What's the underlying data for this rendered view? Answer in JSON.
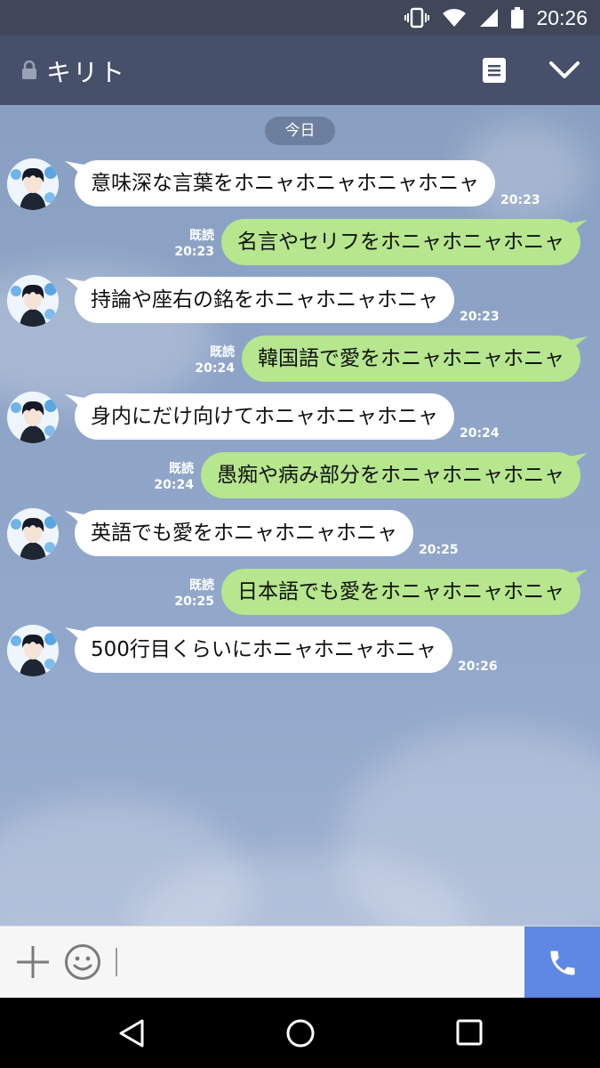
{
  "status_bar": {
    "time": "20:26",
    "icons": [
      "vibrate-icon",
      "wifi-icon",
      "signal-icon",
      "battery-icon"
    ]
  },
  "header": {
    "title": "キリト",
    "icons": [
      "lock-icon",
      "memo-icon",
      "chevron-down-icon"
    ]
  },
  "chat": {
    "date_label": "今日",
    "messages": [
      {
        "dir": "in",
        "text": "意味深な言葉をホニャホニャホニャホニャ",
        "time": "20:23"
      },
      {
        "dir": "out",
        "read": "既読",
        "text": "名言やセリフをホニャホニャホニャ",
        "time": "20:23"
      },
      {
        "dir": "in",
        "text": "持論や座右の銘をホニャホニャホニャ",
        "time": "20:23"
      },
      {
        "dir": "out",
        "read": "既読",
        "text": "韓国語で愛をホニャホニャホニャ",
        "time": "20:24"
      },
      {
        "dir": "in",
        "text": "身内にだけ向けてホニャホニャホニャ",
        "time": "20:24"
      },
      {
        "dir": "out",
        "read": "既読",
        "text": "愚痴や病み部分をホニャホニャホニャ",
        "time": "20:24"
      },
      {
        "dir": "in",
        "text": "英語でも愛をホニャホニャホニャ",
        "time": "20:25"
      },
      {
        "dir": "out",
        "read": "既読",
        "text": "日本語でも愛をホニャホニャホニャ",
        "time": "20:25"
      },
      {
        "dir": "in",
        "text": "500行目くらいにホニャホニャホニャ",
        "time": "20:26"
      }
    ]
  },
  "input_bar": {
    "icons": [
      "plus-icon",
      "smile-icon",
      "phone-icon"
    ]
  },
  "nav_bar": {
    "icons": [
      "back-icon",
      "home-icon",
      "recent-apps-icon"
    ]
  },
  "colors": {
    "header": "#46506a",
    "chat_bg": "#8fa5c8",
    "bubble_out": "#b6e68e",
    "bubble_in": "#ffffff",
    "call_button": "#5f88e4"
  }
}
